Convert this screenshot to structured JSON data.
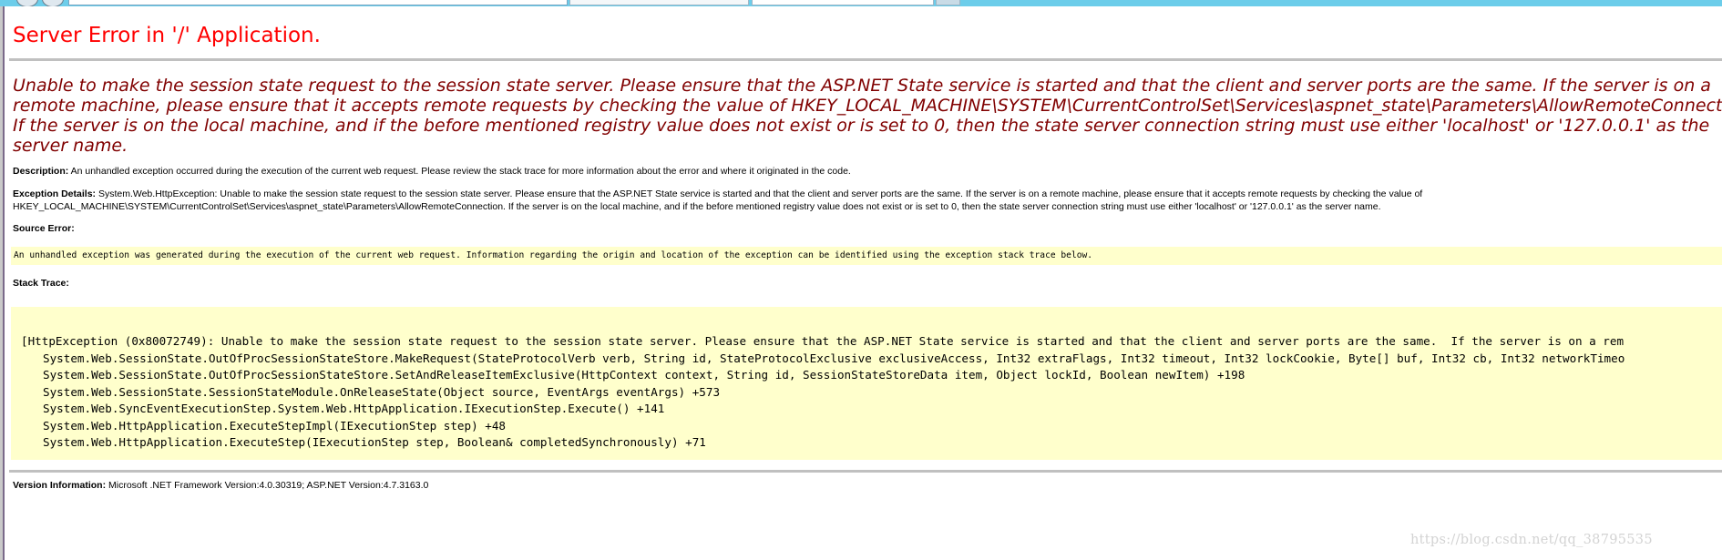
{
  "page": {
    "title": "Server Error in '/' Application.",
    "error_message_lines": [
      "Unable to make the session state request to the session state server. Please ensure that the ASP.NET State service is started and that the client and server ports are the same.  If the server is on a",
      "remote machine, please ensure that it accepts remote requests by checking the value of HKEY_LOCAL_MACHINE\\SYSTEM\\CurrentControlSet\\Services\\aspnet_state\\Parameters\\AllowRemoteConnectio",
      " If the server is on the local machine, and if the before mentioned registry value does not exist or is set to 0, then the state server connection string must use either 'localhost' or '127.0.0.1' as the",
      "server name."
    ],
    "description": {
      "label": "Description:",
      "text": " An unhandled exception occurred during the execution of the current web request. Please review the stack trace for more information about the error and where it originated in the code."
    },
    "exception_details": {
      "label": "Exception Details:",
      "line1": " System.Web.HttpException: Unable to make the session state request to the session state server. Please ensure that the ASP.NET State service is started and that the client and server ports are the same.  If the server is on a remote machine, please ensure that it accepts remote requests by checking the value of",
      "line2": "HKEY_LOCAL_MACHINE\\SYSTEM\\CurrentControlSet\\Services\\aspnet_state\\Parameters\\AllowRemoteConnection.  If the server is on the local machine, and if the before mentioned registry value does not exist or is set to 0, then the state server connection string must use either 'localhost' or '127.0.0.1' as the server name."
    },
    "source_error": {
      "label": "Source Error:",
      "text": "An unhandled exception was generated during the execution of the current web request. Information regarding the origin and location of the exception can be identified using the exception stack trace below."
    },
    "stack_trace": {
      "label": "Stack Trace:",
      "lines": [
        "[HttpException (0x80072749): Unable to make the session state request to the session state server. Please ensure that the ASP.NET State service is started and that the client and server ports are the same.  If the server is on a rem",
        "System.Web.SessionState.OutOfProcSessionStateStore.MakeRequest(StateProtocolVerb verb, String id, StateProtocolExclusive exclusiveAccess, Int32 extraFlags, Int32 timeout, Int32 lockCookie, Byte[] buf, Int32 cb, Int32 networkTimeo",
        "System.Web.SessionState.OutOfProcSessionStateStore.SetAndReleaseItemExclusive(HttpContext context, String id, SessionStateStoreData item, Object lockId, Boolean newItem) +198",
        "System.Web.SessionState.SessionStateModule.OnReleaseState(Object source, EventArgs eventArgs) +573",
        "System.Web.SyncEventExecutionStep.System.Web.HttpApplication.IExecutionStep.Execute() +141",
        "System.Web.HttpApplication.ExecuteStepImpl(IExecutionStep step) +48",
        "System.Web.HttpApplication.ExecuteStep(IExecutionStep step, Boolean& completedSynchronously) +71"
      ]
    },
    "version_info": {
      "label": "Version Information:",
      "text": " Microsoft .NET Framework Version:4.0.30319; ASP.NET Version:4.7.3163.0"
    },
    "watermark": "https://blog.csdn.net/qq_38795535"
  },
  "colors": {
    "title": "#ff0000",
    "error_message": "#800000",
    "code_background": "#ffffcc",
    "rule": "#c0c0c0",
    "browser_chrome": "#6ccdea"
  },
  "icons": {
    "back": "back-arrow-icon",
    "forward": "forward-arrow-icon"
  }
}
